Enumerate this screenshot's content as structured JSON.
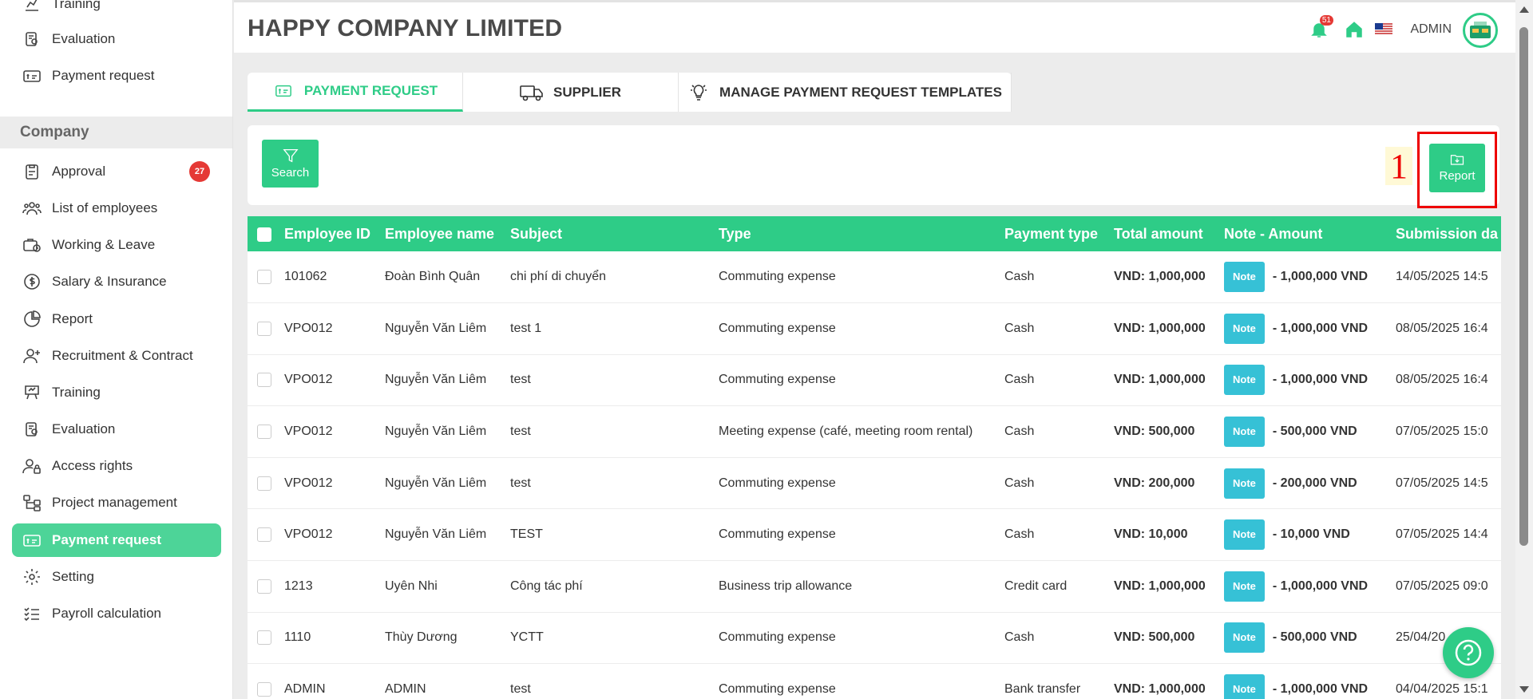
{
  "sidebar": {
    "top_items": [
      {
        "label": "Training",
        "icon": "training-icon"
      },
      {
        "label": "Evaluation",
        "icon": "evaluation-icon"
      },
      {
        "label": "Payment request",
        "icon": "payment-request-icon"
      }
    ],
    "section_title": "Company",
    "items": [
      {
        "label": "Approval",
        "icon": "clipboard-icon",
        "badge": "27"
      },
      {
        "label": "List of employees",
        "icon": "users-icon"
      },
      {
        "label": "Working & Leave",
        "icon": "briefcase-clock-icon"
      },
      {
        "label": "Salary & Insurance",
        "icon": "dollar-coin-icon"
      },
      {
        "label": "Report",
        "icon": "pie-chart-icon"
      },
      {
        "label": "Recruitment & Contract",
        "icon": "user-plus-icon"
      },
      {
        "label": "Training",
        "icon": "training-icon"
      },
      {
        "label": "Evaluation",
        "icon": "evaluation-icon"
      },
      {
        "label": "Access rights",
        "icon": "user-lock-icon"
      },
      {
        "label": "Project management",
        "icon": "project-tree-icon"
      },
      {
        "label": "Payment request",
        "icon": "payment-request-icon",
        "active": true
      },
      {
        "label": "Setting",
        "icon": "gear-icon"
      },
      {
        "label": "Payroll calculation",
        "icon": "checklist-icon"
      }
    ]
  },
  "header": {
    "company_name": "HAPPY COMPANY LIMITED",
    "notification_count": "51",
    "user_label": "ADMIN"
  },
  "tabs": [
    {
      "label": "PAYMENT REQUEST",
      "icon": "payment-request-icon",
      "active": true
    },
    {
      "label": "SUPPLIER",
      "icon": "truck-icon"
    },
    {
      "label": "MANAGE PAYMENT REQUEST TEMPLATES",
      "icon": "lightbulb-icon"
    }
  ],
  "toolbar": {
    "search_label": "Search",
    "report_label": "Report",
    "step_number": "1"
  },
  "table": {
    "columns": [
      "Employee ID",
      "Employee name",
      "Subject",
      "Type",
      "Payment type",
      "Total amount",
      "Note - Amount",
      "Submission da"
    ],
    "note_label": "Note",
    "rows": [
      {
        "id": "101062",
        "name": "Đoàn Bình Quân",
        "subject": "chi phí di chuyển",
        "type": "Commuting expense",
        "payment": "Cash",
        "total": "VND: 1,000,000",
        "note_amount": "- 1,000,000 VND",
        "date": "14/05/2025 14:5"
      },
      {
        "id": "VPO012",
        "name": "Nguyễn Văn Liêm",
        "subject": "test 1",
        "type": "Commuting expense",
        "payment": "Cash",
        "total": "VND: 1,000,000",
        "note_amount": "- 1,000,000 VND",
        "date": "08/05/2025 16:4"
      },
      {
        "id": "VPO012",
        "name": "Nguyễn Văn Liêm",
        "subject": "test",
        "type": "Commuting expense",
        "payment": "Cash",
        "total": "VND: 1,000,000",
        "note_amount": "- 1,000,000 VND",
        "date": "08/05/2025 16:4"
      },
      {
        "id": "VPO012",
        "name": "Nguyễn Văn Liêm",
        "subject": "test",
        "type": "Meeting expense (café, meeting room rental)",
        "payment": "Cash",
        "total": "VND: 500,000",
        "note_amount": "- 500,000 VND",
        "date": "07/05/2025 15:0"
      },
      {
        "id": "VPO012",
        "name": "Nguyễn Văn Liêm",
        "subject": "test",
        "type": "Commuting expense",
        "payment": "Cash",
        "total": "VND: 200,000",
        "note_amount": "- 200,000 VND",
        "date": "07/05/2025 14:5"
      },
      {
        "id": "VPO012",
        "name": "Nguyễn Văn Liêm",
        "subject": "TEST",
        "type": "Commuting expense",
        "payment": "Cash",
        "total": "VND: 10,000",
        "note_amount": "- 10,000 VND",
        "date": "07/05/2025 14:4"
      },
      {
        "id": "1213",
        "name": "Uyên Nhi",
        "subject": "Công tác phí",
        "type": "Business trip allowance",
        "payment": "Credit card",
        "total": "VND: 1,000,000",
        "note_amount": "- 1,000,000 VND",
        "date": "07/05/2025 09:0"
      },
      {
        "id": "1110",
        "name": "Thùy Dương",
        "subject": "YCTT",
        "type": "Commuting expense",
        "payment": "Cash",
        "total": "VND: 500,000",
        "note_amount": "- 500,000 VND",
        "date": "25/04/20"
      },
      {
        "id": "ADMIN",
        "name": "ADMIN",
        "subject": "test",
        "type": "Commuting expense",
        "payment": "Bank transfer",
        "total": "VND: 1,000,000",
        "note_amount": "- 1,000,000 VND",
        "date": "04/04/2025 15:1"
      }
    ]
  },
  "colors": {
    "accent": "#2ecc87",
    "sidebar_active": "#4dd498",
    "note_button": "#36c1d6",
    "badge": "#e53935",
    "highlight": "#ee0000"
  }
}
